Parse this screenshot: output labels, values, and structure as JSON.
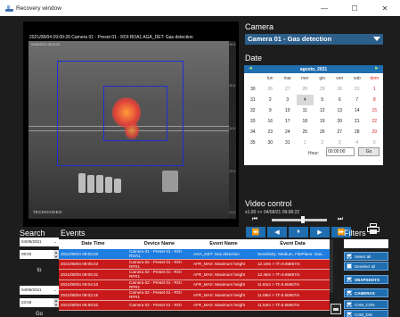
{
  "window": {
    "title": "Recovery window",
    "controls": {
      "minimize": "—",
      "maximize": "☐",
      "close": "✕"
    }
  },
  "video": {
    "caption": "2021/08/04 09:00:20 Camera 01 - Preset 01 - ROI:ROA1 AGA_DET: Gas detection",
    "frame_timestamp": "04/08/2021 09:00:20",
    "brand": "TECNOVIDEO",
    "scale_top": "28.5",
    "scale_mid1": "26.5",
    "scale_mid2": "24.5",
    "scale_mid3": "22.5",
    "scale_bottom": "21.5"
  },
  "camera": {
    "section_title": "Camera",
    "selected": "Camera 01 - Gas detection"
  },
  "date": {
    "section_title": "Date",
    "month_label": "agosto,  2021",
    "prev": "◄",
    "next": "►",
    "weekdays": [
      "lun",
      "mar",
      "mer",
      "gio",
      "ven",
      "sab",
      "dom"
    ],
    "weeks": [
      [
        "30",
        "26",
        "27",
        "28",
        "29",
        "30",
        "31",
        "1"
      ],
      [
        "31",
        "2",
        "3",
        "4",
        "5",
        "6",
        "7",
        "8"
      ],
      [
        "32",
        "9",
        "10",
        "11",
        "12",
        "13",
        "14",
        "15"
      ],
      [
        "33",
        "16",
        "17",
        "18",
        "19",
        "20",
        "21",
        "22"
      ],
      [
        "34",
        "23",
        "24",
        "25",
        "26",
        "27",
        "28",
        "29"
      ],
      [
        "35",
        "30",
        "31",
        "1",
        "2",
        "3",
        "4",
        "5"
      ]
    ],
    "hour_label": "Hour:",
    "hour_value": "00:00:00",
    "go_label": "Go"
  },
  "video_control": {
    "section_title": "Video control",
    "info": "x1.00 >>   04/08/21 09:08:22",
    "playback_position": 0.57,
    "buttons": {
      "begin": "⏮",
      "end": "⏭",
      "rewind": "⏪",
      "prev": "◀",
      "pause": "⏸",
      "play": "▶",
      "forward": "⏩"
    }
  },
  "search": {
    "section_title": "Search",
    "date_from": "04/08/2021",
    "time_from": "08:00",
    "to_label": "to",
    "date_to": "04/08/2021",
    "time_to": "23:59",
    "go_label": "Go"
  },
  "events": {
    "section_title": "Events",
    "columns": [
      "Date Time",
      "Device Name",
      "Event Name",
      "Event Data"
    ],
    "rows": [
      [
        "2021/08/04 09:00:20",
        "Camera 01 - Preset 01 - ROI ROA1",
        "AGA_DET: Gas detection",
        "Sensitivity: Medium, FilePlane: Gas..."
      ],
      [
        "2021/08/04 09:05:43",
        "Camera 02 - Preset 01 - ROI RFR1",
        "AFR_MAX: Maximum height",
        "12.19m > Th 8.65657m"
      ],
      [
        "2021/08/04 09:05:31",
        "Camera 02 - Preset 01 - ROI RFR1",
        "AFR_MAX: Maximum height",
        "12.45m > Th 8.65657m"
      ],
      [
        "2021/08/04 09:04:10",
        "Camera 02 - Preset 01 - ROI RFR1",
        "AFR_MAX: Maximum height",
        "11.81m > Th 8.65657m"
      ],
      [
        "2021/08/04 09:02:15",
        "Camera 02 - Preset 01 - ROI RFR1",
        "AFR_MAX: Maximum height",
        "11.08m > Th 8.65657m"
      ],
      [
        "2021/08/04 08:58:52",
        "Camera 02 - Preset 01 - ROI",
        "AFR_MAX: Maximum height",
        "11.54m > Th 8.65657m"
      ]
    ]
  },
  "filters": {
    "section_title": "Filters",
    "select_all": "Select all",
    "deselect_all": "Deselect all",
    "snapshots": "SNAPSHOTS",
    "cameras": "CAMERAS",
    "cam_con": "CAM_CON",
    "cam_dis": "CAM_DIS"
  },
  "colors": {
    "background": "#1d1d1d",
    "accent": "#1f6eb0",
    "event_row": "#c81a1a",
    "selected_row": "#1e7de0",
    "roi_box": "#1f2fd6"
  }
}
